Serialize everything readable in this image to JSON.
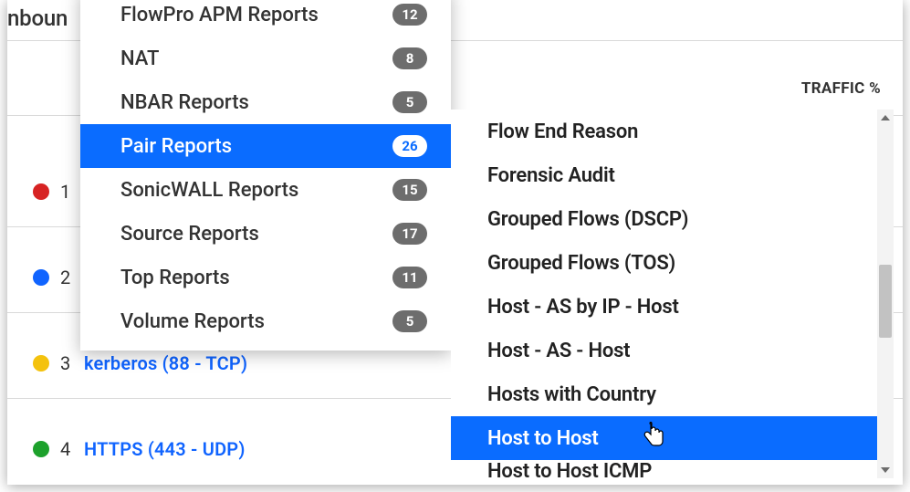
{
  "background": {
    "title_fragment": "nboun",
    "traffic_header": "TRAFFIC %",
    "rows": [
      {
        "n": "1",
        "color": "red",
        "label": ""
      },
      {
        "n": "2",
        "color": "blue",
        "label": ""
      },
      {
        "n": "3",
        "color": "yellow",
        "label": "kerberos (88 - TCP)"
      },
      {
        "n": "4",
        "color": "green",
        "label": "HTTPS (443 - UDP)"
      }
    ]
  },
  "menu": {
    "items": [
      {
        "label": "FlowPro APM Reports",
        "count": "12",
        "selected": false
      },
      {
        "label": "NAT",
        "count": "8",
        "selected": false
      },
      {
        "label": "NBAR Reports",
        "count": "5",
        "selected": false
      },
      {
        "label": "Pair Reports",
        "count": "26",
        "selected": true
      },
      {
        "label": "SonicWALL Reports",
        "count": "15",
        "selected": false
      },
      {
        "label": "Source Reports",
        "count": "17",
        "selected": false
      },
      {
        "label": "Top Reports",
        "count": "11",
        "selected": false
      },
      {
        "label": "Volume Reports",
        "count": "5",
        "selected": false
      }
    ]
  },
  "submenu": {
    "items": [
      {
        "label": "Flow End Reason",
        "selected": false
      },
      {
        "label": "Forensic Audit",
        "selected": false
      },
      {
        "label": "Grouped Flows (DSCP)",
        "selected": false
      },
      {
        "label": "Grouped Flows (TOS)",
        "selected": false
      },
      {
        "label": "Host  - AS by IP - Host",
        "selected": false
      },
      {
        "label": "Host - AS - Host",
        "selected": false
      },
      {
        "label": "Hosts with Country",
        "selected": false
      },
      {
        "label": "Host to Host",
        "selected": true
      },
      {
        "label": "Host to Host ICMP",
        "selected": false,
        "clipped": true
      }
    ]
  }
}
